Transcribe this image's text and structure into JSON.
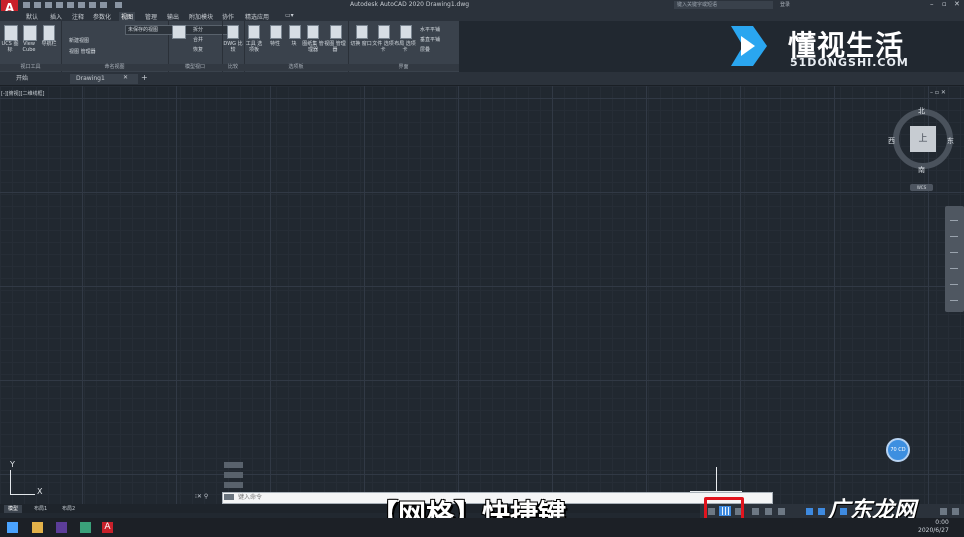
{
  "app": {
    "title": "Autodesk AutoCAD 2020    Drawing1.dwg",
    "search_placeholder": "键入关键字或短语",
    "user": "登录"
  },
  "menu_tabs": [
    "默认",
    "插入",
    "注释",
    "参数化",
    "视图",
    "管理",
    "输出",
    "附加模块",
    "协作",
    "精选应用",
    "▭▾"
  ],
  "ribbon": {
    "buttons": [
      "UCS 图标",
      "View Cube",
      "导航栏",
      "工具 选项板",
      "特性",
      "块",
      "图纸集 管理器",
      "视图 管理器",
      "DWG 比较",
      "切换 窗口",
      "文件 选项卡",
      "布局 选项卡",
      "显示"
    ],
    "view_dropdown": "未保存的视图",
    "small_buttons": [
      "新建视图",
      "视图 管理器",
      "拆分",
      "合并",
      "恢复",
      "水平平铺",
      "垂直平铺",
      "层叠"
    ],
    "groups": [
      "视口工具",
      "命名视图",
      "模型视口",
      "比较",
      "选项板",
      "界面"
    ]
  },
  "doc_tabs": [
    "开始",
    "Drawing1"
  ],
  "viewport_label": "[-][俯视][二维线框]",
  "viewcube": {
    "face": "上",
    "north": "北",
    "south": "南",
    "east": "东",
    "west": "西",
    "wcs": "WCS"
  },
  "ucs": {
    "x": "X",
    "y": "Y"
  },
  "command": {
    "placeholder": "键入命令"
  },
  "layout_tabs": [
    "模型",
    "布局1",
    "布局2"
  ],
  "caption": "【网格】快捷键",
  "watermark": {
    "brand": "懂视生活",
    "url": "51DONGSHI.COM",
    "site": "广东龙网"
  },
  "circle_label": "70 CD",
  "clock": {
    "time": "0:00",
    "date": "2020/6/27"
  },
  "colors": {
    "background": "#212830",
    "highlight": "#e1141e",
    "accent": "#3e8ae0"
  }
}
